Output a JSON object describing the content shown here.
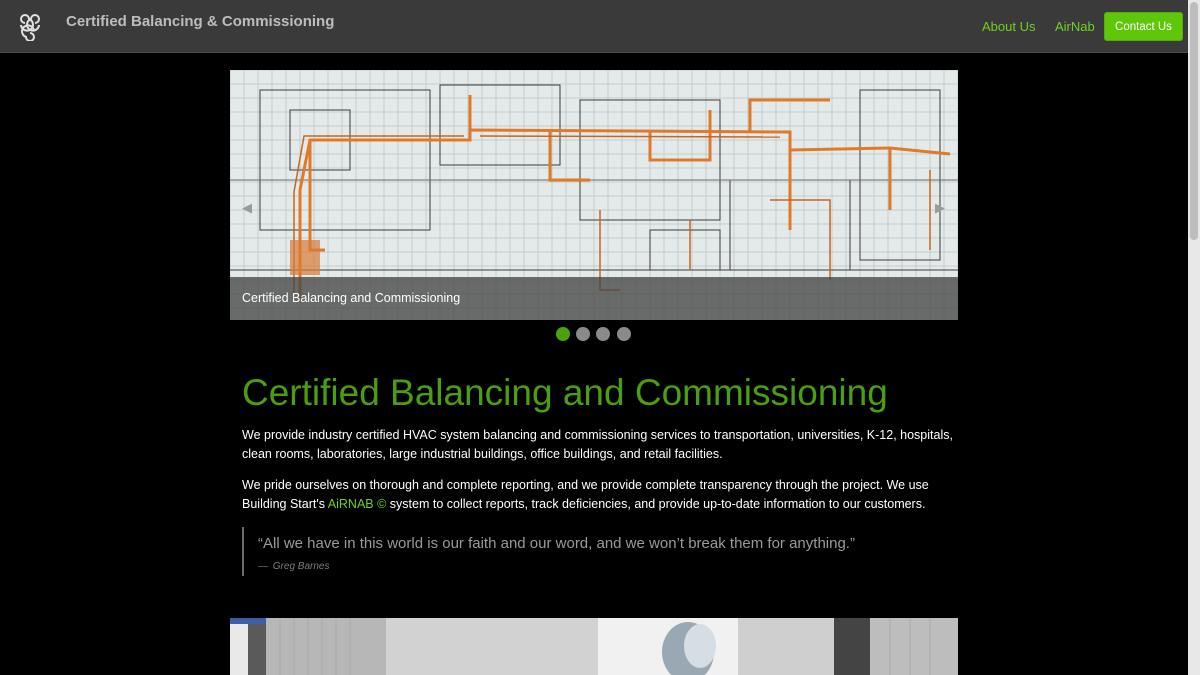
{
  "nav": {
    "brand": "Certified Balancing & Commissioning",
    "links": [
      "About Us",
      "AirNab"
    ],
    "cta": "Contact Us",
    "accent_color": "#6fd11f",
    "logo_icon": "triple-spiral-icon"
  },
  "carousel": {
    "caption": "Certified Balancing and Commissioning",
    "prev_icon": "triangle-left-icon",
    "next_icon": "triangle-right-icon",
    "slide_count": 4,
    "active_slide": 1
  },
  "main": {
    "heading": "Certified Balancing and Commissioning",
    "para1": "We provide industry certified HVAC system balancing and commissioning services to transportation, universities, K-12, hospitals, clean rooms, laboratories, large industrial buildings, office buildings, and retail facilities.",
    "para2_before": "We pride ourselves on thorough and complete reporting, and we provide complete transparency through the project. We use Building Start's ",
    "para2_link": "AiRNAB ©",
    "para2_after": " system to collect reports, track deficiencies, and provide up-to-date information to our customers.",
    "quote": "“All we have in this world is our faith and our word, and we won’t break them for anything.”",
    "quote_dash": "—",
    "quote_author": "Greg Barnes"
  }
}
